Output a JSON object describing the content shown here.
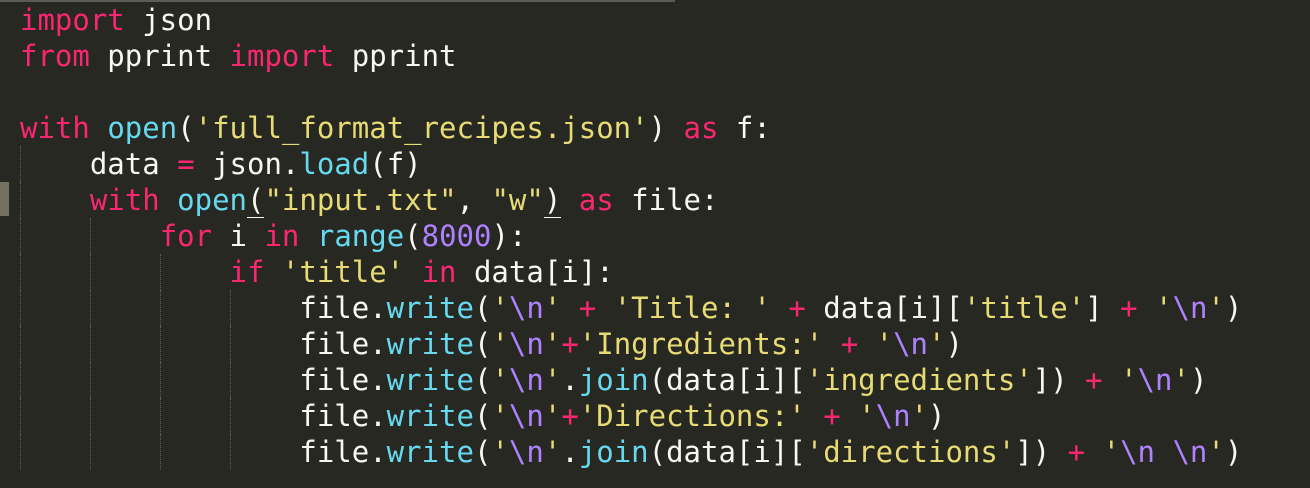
{
  "editor": {
    "colors": {
      "background": "#272822",
      "keyword": "#f92672",
      "function": "#66d9ef",
      "string": "#e6db74",
      "number": "#ae81ff",
      "plain": "#f8f8f2"
    },
    "lines": [
      {
        "indent": 0,
        "tokens": [
          {
            "t": "kw",
            "v": "import"
          },
          {
            "t": "pl",
            "v": " json"
          }
        ]
      },
      {
        "indent": 0,
        "tokens": [
          {
            "t": "kw",
            "v": "from"
          },
          {
            "t": "pl",
            "v": " pprint "
          },
          {
            "t": "kw",
            "v": "import"
          },
          {
            "t": "pl",
            "v": " pprint"
          }
        ]
      },
      {
        "indent": 0,
        "tokens": []
      },
      {
        "indent": 0,
        "tokens": [
          {
            "t": "kw",
            "v": "with"
          },
          {
            "t": "pl",
            "v": " "
          },
          {
            "t": "fn",
            "v": "open"
          },
          {
            "t": "pl",
            "v": "("
          },
          {
            "t": "str",
            "v": "'full_format_recipes.json'"
          },
          {
            "t": "pl",
            "v": ") "
          },
          {
            "t": "kw",
            "v": "as"
          },
          {
            "t": "pl",
            "v": " f:"
          }
        ]
      },
      {
        "indent": 1,
        "tokens": [
          {
            "t": "pl",
            "v": "data "
          },
          {
            "t": "op",
            "v": "="
          },
          {
            "t": "pl",
            "v": " json."
          },
          {
            "t": "fn",
            "v": "load"
          },
          {
            "t": "pl",
            "v": "(f)"
          }
        ]
      },
      {
        "indent": 1,
        "tokens": [
          {
            "t": "kw",
            "v": "with"
          },
          {
            "t": "pl",
            "v": " "
          },
          {
            "t": "fn",
            "v": "open"
          },
          {
            "t": "pl",
            "v": "(",
            "mark": true
          },
          {
            "t": "str",
            "v": "\"input.txt\""
          },
          {
            "t": "pl",
            "v": ", "
          },
          {
            "t": "str",
            "v": "\"w\""
          },
          {
            "t": "pl",
            "v": ")",
            "mark": true
          },
          {
            "t": "pl",
            "v": " "
          },
          {
            "t": "kw",
            "v": "as"
          },
          {
            "t": "pl",
            "v": " file:"
          }
        ]
      },
      {
        "indent": 2,
        "tokens": [
          {
            "t": "kw",
            "v": "for"
          },
          {
            "t": "pl",
            "v": " i "
          },
          {
            "t": "kw",
            "v": "in"
          },
          {
            "t": "pl",
            "v": " "
          },
          {
            "t": "fn",
            "v": "range"
          },
          {
            "t": "pl",
            "v": "("
          },
          {
            "t": "num",
            "v": "8000"
          },
          {
            "t": "pl",
            "v": "):"
          }
        ]
      },
      {
        "indent": 3,
        "tokens": [
          {
            "t": "kw",
            "v": "if"
          },
          {
            "t": "pl",
            "v": " "
          },
          {
            "t": "str",
            "v": "'title'"
          },
          {
            "t": "pl",
            "v": " "
          },
          {
            "t": "kw",
            "v": "in"
          },
          {
            "t": "pl",
            "v": " data[i]:"
          }
        ]
      },
      {
        "indent": 4,
        "tokens": [
          {
            "t": "pl",
            "v": "file."
          },
          {
            "t": "fn",
            "v": "write"
          },
          {
            "t": "pl",
            "v": "("
          },
          {
            "t": "str",
            "v": "'"
          },
          {
            "t": "esc",
            "v": "\\n"
          },
          {
            "t": "str",
            "v": "'"
          },
          {
            "t": "pl",
            "v": " "
          },
          {
            "t": "op",
            "v": "+"
          },
          {
            "t": "pl",
            "v": " "
          },
          {
            "t": "str",
            "v": "'Title: '"
          },
          {
            "t": "pl",
            "v": " "
          },
          {
            "t": "op",
            "v": "+"
          },
          {
            "t": "pl",
            "v": " data[i]["
          },
          {
            "t": "str",
            "v": "'title'"
          },
          {
            "t": "pl",
            "v": "] "
          },
          {
            "t": "op",
            "v": "+"
          },
          {
            "t": "pl",
            "v": " "
          },
          {
            "t": "str",
            "v": "'"
          },
          {
            "t": "esc",
            "v": "\\n"
          },
          {
            "t": "str",
            "v": "'"
          },
          {
            "t": "pl",
            "v": ")"
          }
        ]
      },
      {
        "indent": 4,
        "tokens": [
          {
            "t": "pl",
            "v": "file."
          },
          {
            "t": "fn",
            "v": "write"
          },
          {
            "t": "pl",
            "v": "("
          },
          {
            "t": "str",
            "v": "'"
          },
          {
            "t": "esc",
            "v": "\\n"
          },
          {
            "t": "str",
            "v": "'"
          },
          {
            "t": "op",
            "v": "+"
          },
          {
            "t": "str",
            "v": "'Ingredients:'"
          },
          {
            "t": "pl",
            "v": " "
          },
          {
            "t": "op",
            "v": "+"
          },
          {
            "t": "pl",
            "v": " "
          },
          {
            "t": "str",
            "v": "'"
          },
          {
            "t": "esc",
            "v": "\\n"
          },
          {
            "t": "str",
            "v": "'"
          },
          {
            "t": "pl",
            "v": ")"
          }
        ]
      },
      {
        "indent": 4,
        "tokens": [
          {
            "t": "pl",
            "v": "file."
          },
          {
            "t": "fn",
            "v": "write"
          },
          {
            "t": "pl",
            "v": "("
          },
          {
            "t": "str",
            "v": "'"
          },
          {
            "t": "esc",
            "v": "\\n"
          },
          {
            "t": "str",
            "v": "'"
          },
          {
            "t": "pl",
            "v": "."
          },
          {
            "t": "fn",
            "v": "join"
          },
          {
            "t": "pl",
            "v": "(data[i]["
          },
          {
            "t": "str",
            "v": "'ingredients'"
          },
          {
            "t": "pl",
            "v": "]) "
          },
          {
            "t": "op",
            "v": "+"
          },
          {
            "t": "pl",
            "v": " "
          },
          {
            "t": "str",
            "v": "'"
          },
          {
            "t": "esc",
            "v": "\\n"
          },
          {
            "t": "str",
            "v": "'"
          },
          {
            "t": "pl",
            "v": ")"
          }
        ]
      },
      {
        "indent": 4,
        "tokens": [
          {
            "t": "pl",
            "v": "file."
          },
          {
            "t": "fn",
            "v": "write"
          },
          {
            "t": "pl",
            "v": "("
          },
          {
            "t": "str",
            "v": "'"
          },
          {
            "t": "esc",
            "v": "\\n"
          },
          {
            "t": "str",
            "v": "'"
          },
          {
            "t": "op",
            "v": "+"
          },
          {
            "t": "str",
            "v": "'Directions:'"
          },
          {
            "t": "pl",
            "v": " "
          },
          {
            "t": "op",
            "v": "+"
          },
          {
            "t": "pl",
            "v": " "
          },
          {
            "t": "str",
            "v": "'"
          },
          {
            "t": "esc",
            "v": "\\n"
          },
          {
            "t": "str",
            "v": "'"
          },
          {
            "t": "pl",
            "v": ")"
          }
        ]
      },
      {
        "indent": 4,
        "tokens": [
          {
            "t": "pl",
            "v": "file."
          },
          {
            "t": "fn",
            "v": "write"
          },
          {
            "t": "pl",
            "v": "("
          },
          {
            "t": "str",
            "v": "'"
          },
          {
            "t": "esc",
            "v": "\\n"
          },
          {
            "t": "str",
            "v": "'"
          },
          {
            "t": "pl",
            "v": "."
          },
          {
            "t": "fn",
            "v": "join"
          },
          {
            "t": "pl",
            "v": "(data[i]["
          },
          {
            "t": "str",
            "v": "'directions'"
          },
          {
            "t": "pl",
            "v": "]) "
          },
          {
            "t": "op",
            "v": "+"
          },
          {
            "t": "pl",
            "v": " "
          },
          {
            "t": "str",
            "v": "'"
          },
          {
            "t": "esc",
            "v": "\\n"
          },
          {
            "t": "str",
            "v": " "
          },
          {
            "t": "esc",
            "v": "\\n"
          },
          {
            "t": "str",
            "v": "'"
          },
          {
            "t": "pl",
            "v": ")"
          }
        ]
      }
    ]
  }
}
